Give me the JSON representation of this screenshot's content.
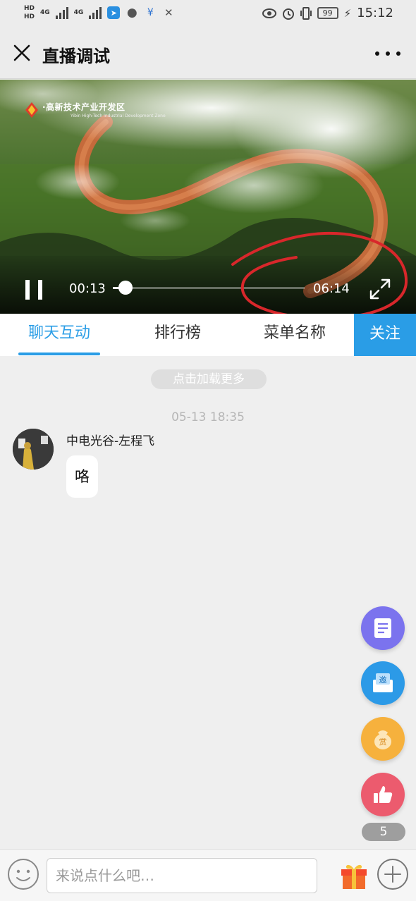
{
  "status_bar": {
    "hd_top": "HD",
    "hd_bottom": "HD",
    "network_1": "4G",
    "network_2": "4G",
    "battery": "99",
    "time": "15:12"
  },
  "header": {
    "title": "直播调试"
  },
  "video": {
    "logo_text": "·高新技术产业开发区",
    "logo_sub": "Yibin High-Tech Industrial Development Zone",
    "current_time": "00:13",
    "total_time": "06:14",
    "progress": 0.035
  },
  "tabs": [
    {
      "label": "聊天互动"
    },
    {
      "label": "排行榜"
    },
    {
      "label": "菜单名称"
    }
  ],
  "follow_label": "关注",
  "chat": {
    "load_more": "点击加载更多",
    "timestamp": "05-13 18:35",
    "messages": [
      {
        "sender": "中电光谷-左程飞",
        "text": "咯"
      }
    ]
  },
  "fabs": {
    "invite_label": "邀",
    "reward_label": "赏",
    "like_count": "5"
  },
  "input": {
    "placeholder": "来说点什么吧…"
  },
  "colors": {
    "accent": "#2a9de6",
    "doc_fab": "#7b73ee",
    "invite_fab": "#2c9ae7",
    "reward_fab": "#f6b13d",
    "like_fab": "#ec5b6e",
    "annotation": "#d8272b"
  }
}
